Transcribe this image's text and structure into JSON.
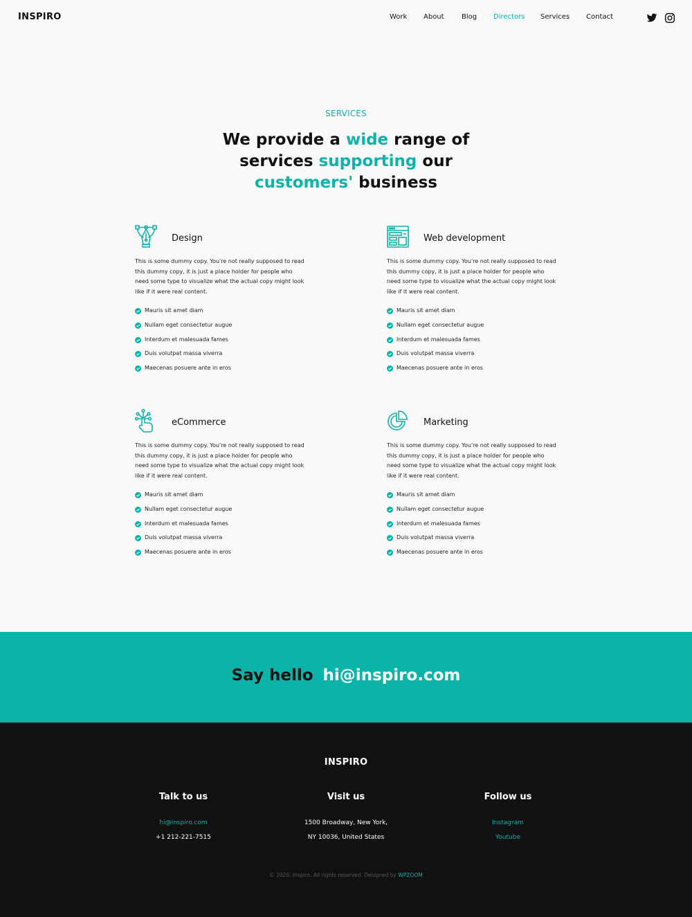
{
  "header": {
    "logo": "INSPIRO",
    "nav": [
      "Work",
      "About",
      "Blog",
      "Directors",
      "Services",
      "Contact"
    ],
    "active_nav": "Directors",
    "social": [
      "twitter-icon",
      "instagram-icon"
    ]
  },
  "hero": {
    "label": "SERVICES",
    "title": {
      "p1": "We provide a ",
      "h1": "wide",
      "p2": " range of services ",
      "h2": "supporting",
      "p3": " our ",
      "h3": "customers'",
      "p4": " business"
    }
  },
  "services": [
    {
      "icon": "pen-tool-icon",
      "title": "Design",
      "desc": "This is some dummy copy. You're not really supposed to read this dummy copy, it is just a place holder for people who need some type to visualize what the actual copy might look like if it were real content.",
      "items": [
        "Mauris sit amet diam",
        "Nullam eget consectetur augue",
        "Interdum et malesuada fames",
        "Duis volutpat massa viverra",
        "Maecenas posuere ante in eros"
      ]
    },
    {
      "icon": "browser-layout-icon",
      "title": "Web development",
      "desc": "This is some dummy copy. You're not really supposed to read this dummy copy, it is just a place holder for people who need some type to visualize what the actual copy might look like if it were real content.",
      "items": [
        "Mauris sit amet diam",
        "Nullam eget consectetur augue",
        "Interdum et malesuada fames",
        "Duis volutpat massa viverra",
        "Maecenas posuere ante in eros"
      ]
    },
    {
      "icon": "touch-network-icon",
      "title": "eCommerce",
      "desc": "This is some dummy copy. You're not really supposed to read this dummy copy, it is just a place holder for people who need some type to visualize what the actual copy might look like if it were real content.",
      "items": [
        "Mauris sit amet diam",
        "Nullam eget consectetur augue",
        "Interdum et malesuada fames",
        "Duis volutpat massa viverra",
        "Maecenas posuere ante in eros"
      ]
    },
    {
      "icon": "pie-chart-icon",
      "title": "Marketing",
      "desc": "This is some dummy copy. You're not really supposed to read this dummy copy, it is just a place holder for people who need some type to visualize what the actual copy might look like if it were real content.",
      "items": [
        "Mauris sit amet diam",
        "Nullam eget consectetur augue",
        "Interdum et malesuada fames",
        "Duis volutpat massa viverra",
        "Maecenas posuere ante in eros"
      ]
    }
  ],
  "cta": {
    "say": "Say hello",
    "email": "hi@inspiro.com"
  },
  "footer": {
    "logo": "INSPIRO",
    "talk": {
      "heading": "Talk to us",
      "email": "hi@inspiro.com",
      "phone": "+1 212-221-7515"
    },
    "visit": {
      "heading": "Visit us",
      "line1": "1500 Broadway, New York,",
      "line2": "NY 10036, United States"
    },
    "follow": {
      "heading": "Follow us",
      "link1": "Instagram",
      "link2": "Youtube"
    },
    "copyright": "© 2020. Inspiro. All rights reserved. Designed by",
    "designer": "WPZOOM"
  },
  "colors": {
    "accent": "#0bb3a9",
    "dark": "#111111",
    "background": "#f9f9f9"
  }
}
